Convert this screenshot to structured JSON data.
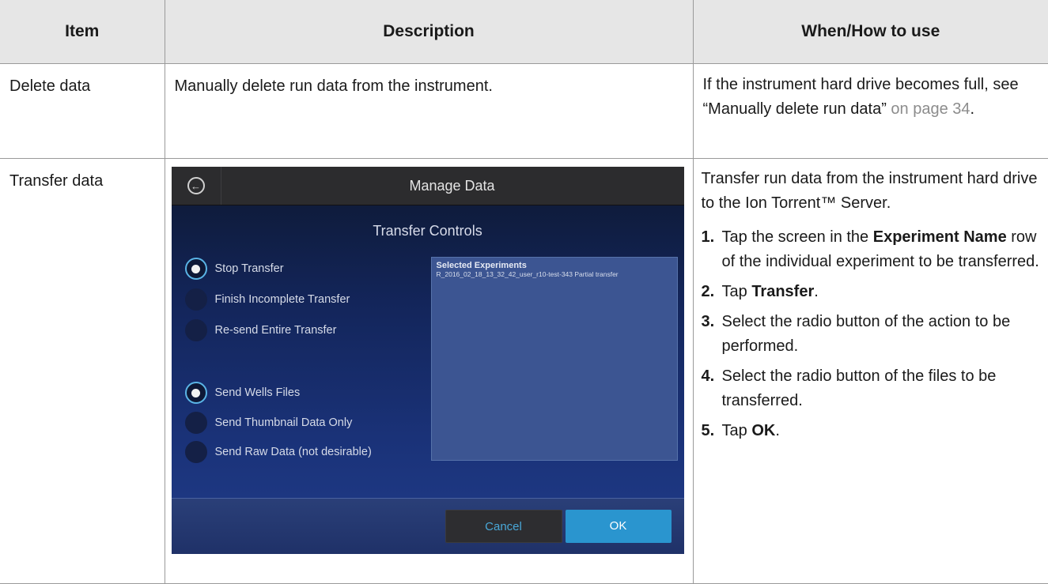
{
  "table": {
    "headers": [
      "Item",
      "Description",
      "When/How to use"
    ],
    "rows": [
      {
        "item": "Delete data",
        "description": "Manually delete run data from the instrument.",
        "usage_text": "If the instrument hard drive becomes full, see “Manually delete run data”",
        "usage_link": "on page 34",
        "usage_end": "."
      },
      {
        "item": "Transfer data",
        "usage_intro": "Transfer run data from the instrument hard drive to the Ion Torrent™ Server.",
        "steps": [
          {
            "num": "1.",
            "pre": "Tap the screen in the ",
            "bold": "Experiment Name",
            "post": " row of the individual experiment to be transferred."
          },
          {
            "num": "2.",
            "pre": "Tap ",
            "bold": "Transfer",
            "post": "."
          },
          {
            "num": "3.",
            "pre": "Select the radio button of the action to be performed.",
            "bold": "",
            "post": ""
          },
          {
            "num": "4.",
            "pre": "Select the radio button of the files to be transferred.",
            "bold": "",
            "post": ""
          },
          {
            "num": "5.",
            "pre": "Tap ",
            "bold": "OK",
            "post": "."
          }
        ]
      }
    ]
  },
  "screen": {
    "title": "Manage Data",
    "subtitle": "Transfer Controls",
    "back_icon": "back-arrow-icon",
    "action_options": [
      {
        "label": "Stop Transfer",
        "selected": true
      },
      {
        "label": "Finish Incomplete Transfer",
        "selected": false
      },
      {
        "label": "Re-send Entire Transfer",
        "selected": false
      }
    ],
    "file_options": [
      {
        "label": "Send Wells Files",
        "selected": true
      },
      {
        "label": "Send Thumbnail Data Only",
        "selected": false
      },
      {
        "label": "Send Raw Data (not desirable)",
        "selected": false
      }
    ],
    "selected_panel": {
      "header": "Selected Experiments",
      "entry": "R_2016_02_18_13_32_42_user_r10-test-343  Partial transfer"
    },
    "cancel_label": "Cancel",
    "ok_label": "OK"
  },
  "colors": {
    "accent": "#2a95cf",
    "radio_ring": "#5ab4e6",
    "header_bg": "#e6e6e6",
    "link": "#8c8c8c"
  }
}
